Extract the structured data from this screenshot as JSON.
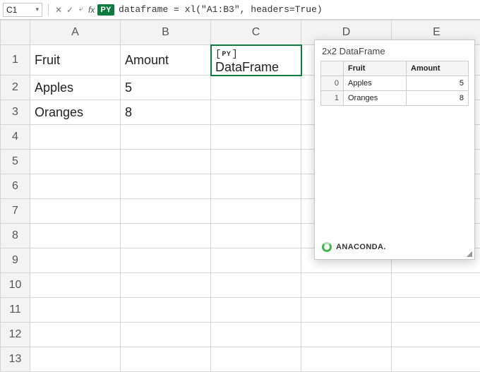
{
  "formula_bar": {
    "name_box": "C1",
    "py_badge": "PY",
    "formula": "dataframe = xl(\"A1:B3\", headers=True)"
  },
  "columns": [
    "A",
    "B",
    "C",
    "D",
    "E"
  ],
  "rows": [
    "1",
    "2",
    "3",
    "4",
    "5",
    "6",
    "7",
    "8",
    "9",
    "10",
    "11",
    "12",
    "13"
  ],
  "cells": {
    "A1": "Fruit",
    "B1": "Amount",
    "C1": "DataFrame",
    "A2": "Apples",
    "B2": "5",
    "A3": "Oranges",
    "B3": "8"
  },
  "preview": {
    "title": "2x2 DataFrame",
    "headers": [
      "",
      "Fruit",
      "Amount"
    ],
    "rows": [
      {
        "idx": "0",
        "fruit": "Apples",
        "amount": "5"
      },
      {
        "idx": "1",
        "fruit": "Oranges",
        "amount": "8"
      }
    ],
    "footer_brand": "ANACONDA."
  },
  "py_chip_label": "PY"
}
